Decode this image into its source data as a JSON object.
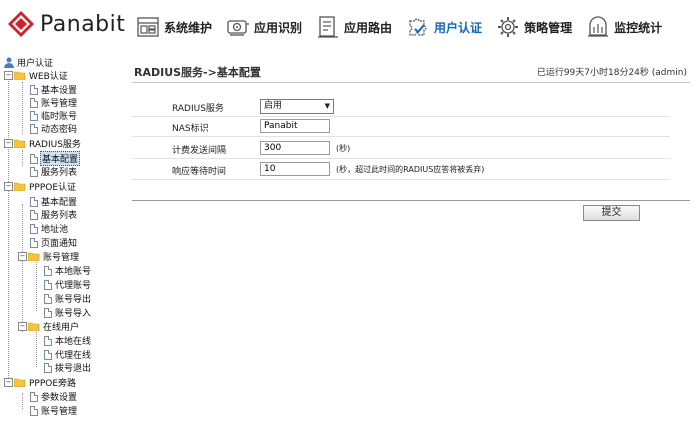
{
  "brand": {
    "name": "Panabit"
  },
  "nav": [
    {
      "label": "系统维护",
      "icon": "system-maintenance-icon"
    },
    {
      "label": "应用识别",
      "icon": "app-recognition-icon"
    },
    {
      "label": "应用路由",
      "icon": "app-routing-icon"
    },
    {
      "label": "用户认证",
      "icon": "user-auth-icon",
      "active": true
    },
    {
      "label": "策略管理",
      "icon": "policy-management-icon"
    },
    {
      "label": "监控统计",
      "icon": "monitoring-stats-icon"
    }
  ],
  "tree": {
    "root": "用户认证",
    "web_auth": "WEB认证",
    "web_basic": "基本设置",
    "web_account": "账号管理",
    "web_temp": "临时账号",
    "web_dynpwd": "动态密码",
    "radius": "RADIUS服务",
    "radius_basic": "基本配置",
    "radius_list": "服务列表",
    "pppoe": "PPPOE认证",
    "pppoe_basic": "基本配置",
    "pppoe_list": "服务列表",
    "pppoe_pool": "地址池",
    "pppoe_notice": "页面通知",
    "acct_mgmt": "账号管理",
    "acct_local": "本地账号",
    "acct_proxy": "代理账号",
    "acct_export": "账号导出",
    "acct_import": "账号导入",
    "online": "在线用户",
    "online_local": "本地在线",
    "online_proxy": "代理在线",
    "online_dialout": "拨号退出",
    "bypass": "PPPOE旁路",
    "bypass_params": "参数设置",
    "bypass_account": "账号管理"
  },
  "main": {
    "title": "RADIUS服务->基本配置",
    "uptime": "已运行99天7小时18分24秒 (admin)",
    "fields": {
      "radius_service_label": "RADIUS服务",
      "radius_service_value": "启用",
      "nas_label": "NAS标识",
      "nas_value": "Panabit",
      "acct_interval_label": "计费发送间隔",
      "acct_interval_value": "300",
      "acct_interval_unit": "(秒)",
      "timeout_label": "响应等待时间",
      "timeout_value": "10",
      "timeout_unit": "(秒，超过此时间的RADIUS应答将被丢弃)"
    },
    "submit_label": "提交"
  },
  "colors": {
    "accent": "#1565c0",
    "logo_red": "#d0202a",
    "folder": "#f2c440"
  }
}
